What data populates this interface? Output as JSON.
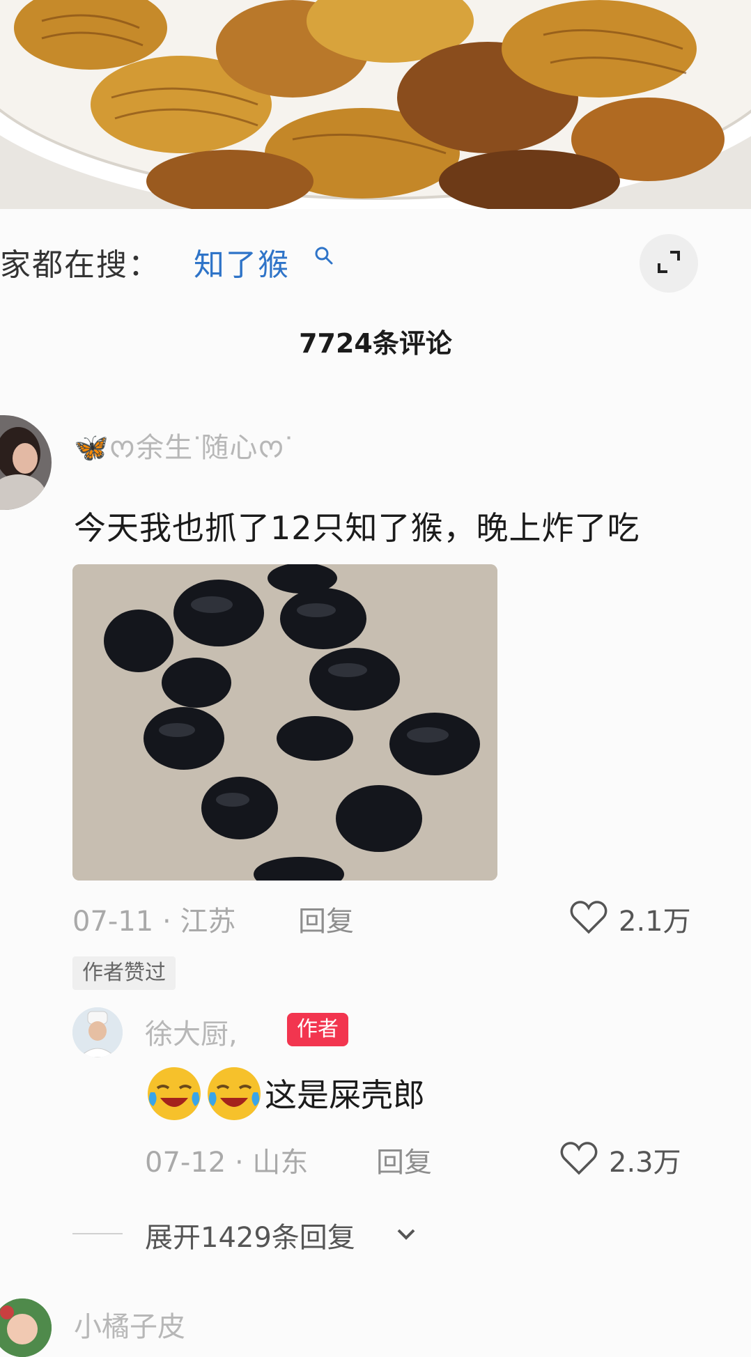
{
  "search_hint": {
    "prefix": "家都在搜：",
    "term": "知了猴"
  },
  "comments_header": {
    "count_label": "7724条评论"
  },
  "comment": {
    "username": "🦋ᰔ余生ᐝ随心ᰔᐝ",
    "text": "今天我也抓了12只知了猴，晚上炸了吃",
    "date": "07-11 · 江苏",
    "reply_label": "回复",
    "likes": "2.1万",
    "liked_badge": "作者赞过"
  },
  "reply": {
    "username": "徐大厨,",
    "author_badge": "作者",
    "text": "这是屎壳郎",
    "emoji": [
      "laughing-crying-emoji",
      "laughing-crying-emoji"
    ],
    "date": "07-12 · 山东",
    "reply_label": "回复",
    "likes": "2.3万"
  },
  "expand_replies": {
    "label": "展开1429条回复"
  },
  "next_comment": {
    "username": "小橘子皮"
  },
  "colors": {
    "link_blue": "#2f74c8",
    "author_badge_red": "#f2354f",
    "muted_text": "#a9a9a9"
  }
}
